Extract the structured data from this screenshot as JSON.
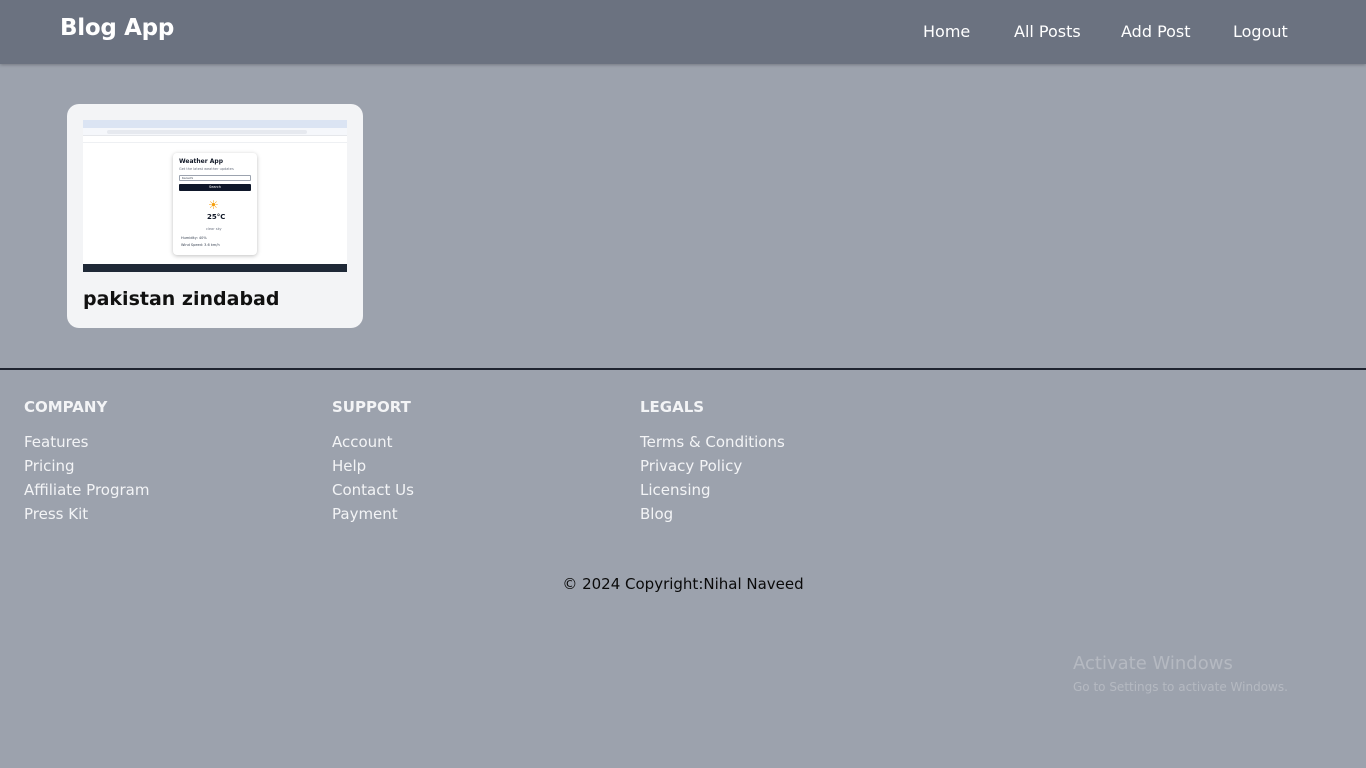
{
  "navbar": {
    "brand": "Blog App",
    "links": [
      {
        "label": "Home"
      },
      {
        "label": "All Posts"
      },
      {
        "label": "Add Post"
      },
      {
        "label": "Logout"
      }
    ]
  },
  "posts": [
    {
      "title": "pakistan zindabad",
      "thumbnail": {
        "app_title": "Weather App",
        "subtitle": "Get the latest weather updates",
        "input_value": "Karachi",
        "button_label": "Search",
        "icon": "partly-cloudy-icon",
        "temperature": "25°C",
        "description": "clear sky",
        "humidity": "Humidity: 40%",
        "wind": "Wind Speed: 3.6 km/h"
      }
    }
  ],
  "footer": {
    "columns": [
      {
        "heading": "COMPANY",
        "links": [
          "Features",
          "Pricing",
          "Affiliate Program",
          "Press Kit"
        ]
      },
      {
        "heading": "SUPPORT",
        "links": [
          "Account",
          "Help",
          "Contact Us",
          "Payment"
        ]
      },
      {
        "heading": "LEGALS",
        "links": [
          "Terms & Conditions",
          "Privacy Policy",
          "Licensing",
          "Blog"
        ]
      }
    ],
    "copyright": "© 2024 Copyright:Nihal Naveed"
  },
  "watermark": {
    "title": "Activate Windows",
    "subtitle": "Go to Settings to activate Windows."
  },
  "colors": {
    "navbar": "#6b7280",
    "background": "#9ca2ad",
    "card": "#f3f4f6"
  }
}
